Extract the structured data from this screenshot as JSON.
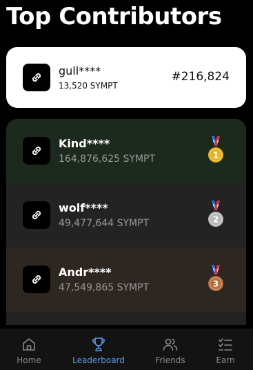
{
  "header": {
    "title": "Top Contributors"
  },
  "my_entry": {
    "name": "gull****",
    "score": "13,520 SYMPT",
    "rank": "#216,824",
    "icon": "link-icon"
  },
  "leaderboard": [
    {
      "name": "Kind****",
      "score": "164,876,625 SYMPT",
      "medal": "1",
      "medal_icon": "gold-medal-icon",
      "row_color": "#1c2a1d",
      "medal_color": "#e4b325"
    },
    {
      "name": "wolf****",
      "score": "49,477,644 SYMPT",
      "medal": "2",
      "medal_icon": "silver-medal-icon",
      "row_color": "#232323",
      "medal_color": "#b9b9b9"
    },
    {
      "name": "Andr****",
      "score": "47,549,865 SYMPT",
      "medal": "3",
      "medal_icon": "bronze-medal-icon",
      "row_color": "#2e2620",
      "medal_color": "#b86f3c"
    }
  ],
  "nav": {
    "items": [
      {
        "label": "Home",
        "icon": "home-icon",
        "active": false
      },
      {
        "label": "Leaderboard",
        "icon": "trophy-icon",
        "active": true
      },
      {
        "label": "Friends",
        "icon": "friends-icon",
        "active": false
      },
      {
        "label": "Earn",
        "icon": "checklist-icon",
        "active": false
      }
    ],
    "active_color": "#5b9cf0"
  }
}
